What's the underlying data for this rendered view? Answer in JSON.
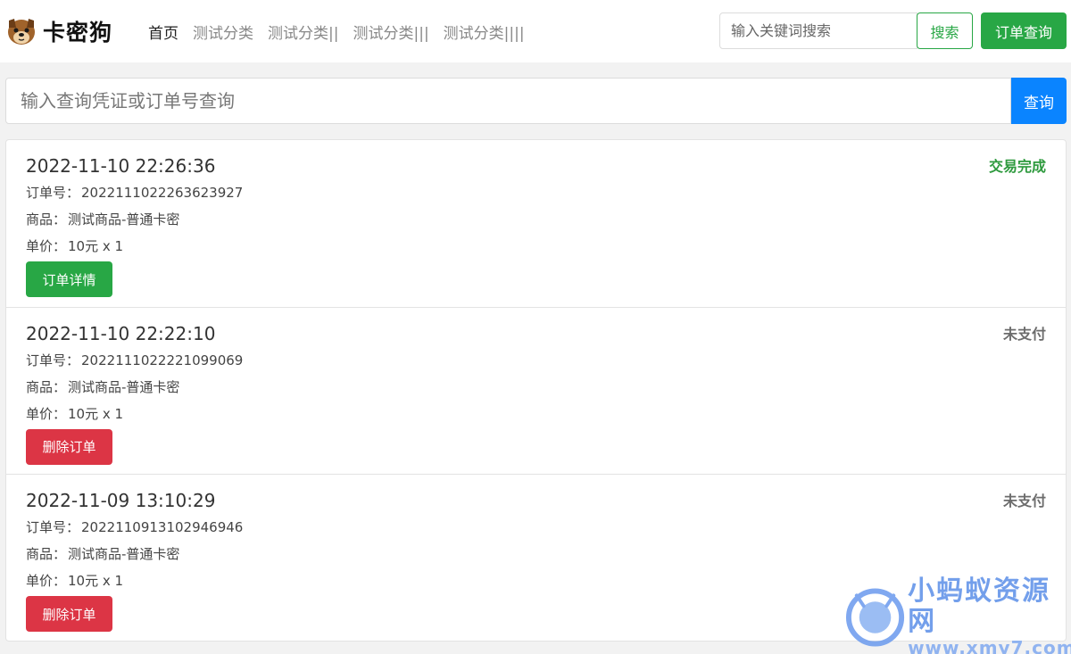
{
  "navbar": {
    "brand_name": "卡密狗",
    "links": [
      {
        "label": "首页",
        "active": true
      },
      {
        "label": "测试分类",
        "active": false
      },
      {
        "label": "测试分类||",
        "active": false
      },
      {
        "label": "测试分类|||",
        "active": false
      },
      {
        "label": "测试分类||||",
        "active": false
      }
    ],
    "search_placeholder": "输入关键词搜索",
    "search_label": "搜索",
    "order_query_label": "订单查询"
  },
  "query": {
    "placeholder": "输入查询凭证或订单号查询",
    "button_label": "查询"
  },
  "orders": [
    {
      "time": "2022-11-10 22:26:36",
      "status": "交易完成",
      "order_no_label": "订单号：",
      "order_no": "2022111022263623927",
      "product_label": "商品：",
      "product": "测试商品-普通卡密",
      "price_label": "单价：",
      "price": "10元 x 1",
      "action_label": "订单详情"
    },
    {
      "time": "2022-11-10 22:22:10",
      "status": "未支付",
      "order_no_label": "订单号：",
      "order_no": "2022111022221099069",
      "product_label": "商品：",
      "product": "测试商品-普通卡密",
      "price_label": "单价：",
      "price": "10元 x 1",
      "action_label": "删除订单"
    },
    {
      "time": "2022-11-09 13:10:29",
      "status": "未支付",
      "order_no_label": "订单号：",
      "order_no": "2022110913102946946",
      "product_label": "商品：",
      "product": "测试商品-普通卡密",
      "price_label": "单价：",
      "price": "10元 x 1",
      "action_label": "删除订单"
    }
  ],
  "watermark": {
    "title": "小蚂蚁资源网",
    "url": "www.xmy7.com"
  },
  "colors": {
    "success_green": "#28a745",
    "status_done": "#2e9a3e",
    "danger_red": "#dc3545",
    "primary_blue": "#0a84ff"
  }
}
